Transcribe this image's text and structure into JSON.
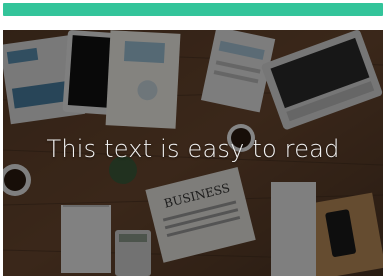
{
  "accent_color": "#33c49a",
  "hero": {
    "caption": "This text is easy to read",
    "newspaper_headline": "BUSINESS",
    "background_description_icon": "desk-photo-icon"
  }
}
